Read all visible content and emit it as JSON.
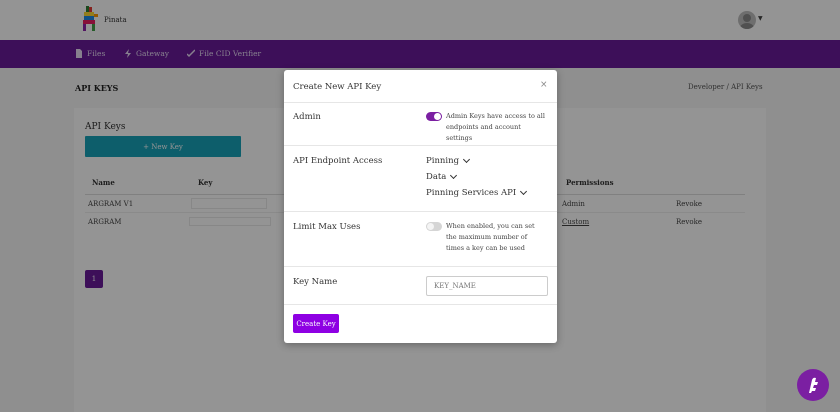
{
  "header": {
    "brand": "Pinata",
    "logo_icon": "pinata-logo-icon",
    "avatar_icon": "user-avatar-icon"
  },
  "nav": {
    "items": [
      {
        "label": "Files",
        "icon": "file-icon"
      },
      {
        "label": "Gateway",
        "icon": "lightning-icon"
      },
      {
        "label": "File CID Verifier",
        "icon": "check-icon"
      }
    ]
  },
  "page": {
    "title": "API KEYS",
    "breadcrumb": [
      "Developer",
      "/",
      "API Keys"
    ]
  },
  "card": {
    "title": "API Keys",
    "new_key_label": "+ New Key",
    "columns": [
      "Name",
      "Key",
      "Permissions"
    ],
    "rows": [
      {
        "name": "ARGRAM V1",
        "permissions": "Admin",
        "action": "Revoke"
      },
      {
        "name": "ARGRAM",
        "permissions": "Custom",
        "action": "Revoke"
      }
    ],
    "page": "1"
  },
  "modal": {
    "title": "Create New API Key",
    "close": "×",
    "admin": {
      "label": "Admin",
      "toggle_on": true,
      "description": "Admin Keys have access to all endpoints and account settings"
    },
    "endpoint_access": {
      "label": "API Endpoint Access",
      "options": [
        "Pinning",
        "Data",
        "Pinning Services API"
      ]
    },
    "limit": {
      "label": "Limit Max Uses",
      "toggle_on": false,
      "description": "When enabled, you can set the maximum number of times a key can be used"
    },
    "key_name": {
      "label": "Key Name",
      "placeholder": "KEY_NAME"
    },
    "submit_label": "Create Key"
  },
  "colors": {
    "nav_purple": "#6a1b9a",
    "teal": "#17a2b8",
    "button_purple": "#8e00e3"
  }
}
